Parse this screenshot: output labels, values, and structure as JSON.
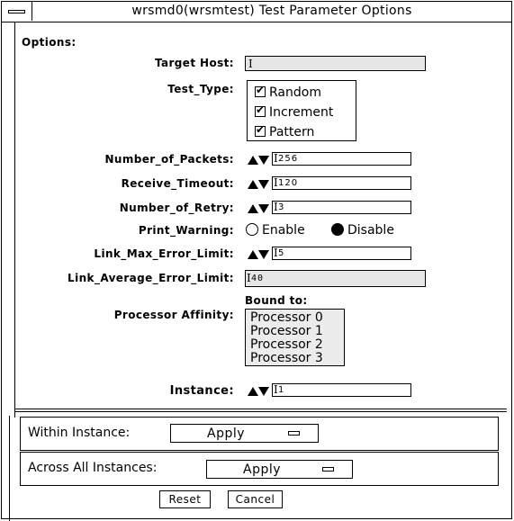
{
  "window": {
    "title": "wrsmd0(wrsmtest) Test Parameter Options"
  },
  "options_label": "Options:",
  "fields": {
    "target_host": {
      "label": "Target Host:",
      "value": ""
    },
    "test_type": {
      "label": "Test_Type:",
      "options": [
        {
          "label": "Random",
          "checked": true
        },
        {
          "label": "Increment",
          "checked": true
        },
        {
          "label": "Pattern",
          "checked": true
        }
      ]
    },
    "number_of_packets": {
      "label": "Number_of_Packets:",
      "value": "256"
    },
    "receive_timeout": {
      "label": "Receive_Timeout:",
      "value": "120"
    },
    "number_of_retry": {
      "label": "Number_of_Retry:",
      "value": "3"
    },
    "print_warning": {
      "label": "Print_Warning:",
      "enable_label": "Enable",
      "disable_label": "Disable",
      "selected": "Disable"
    },
    "link_max_error_limit": {
      "label": "Link_Max_Error_Limit:",
      "value": "5"
    },
    "link_average_error_limit": {
      "label": "Link_Average_Error_Limit:",
      "value": "40"
    },
    "processor_affinity": {
      "label": "Processor Affinity:",
      "bound_to_label": "Bound to:",
      "items": [
        "Processor 0",
        "Processor 1",
        "Processor 2",
        "Processor 3"
      ]
    },
    "instance": {
      "label": "Instance:",
      "value": "1"
    }
  },
  "within_instance": {
    "label": "Within Instance:",
    "button": "Apply"
  },
  "across_all_instances": {
    "label": "Across All Instances:",
    "button": "Apply"
  },
  "buttons": {
    "reset": "Reset",
    "cancel": "Cancel"
  },
  "icons": {
    "menu": "window-menu-icon",
    "spin": "spin-arrows-icon",
    "check": "checkmark-icon",
    "radio": "radio-icon"
  },
  "colors": {
    "background": "#ffffff",
    "readonly_field": "#e6e6e6",
    "list_background": "#ececec",
    "foreground": "#000000"
  }
}
